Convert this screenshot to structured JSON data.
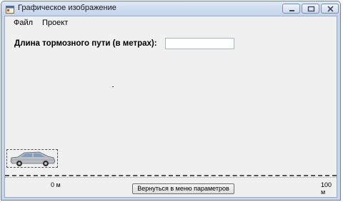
{
  "window": {
    "title": "Графическое изображение"
  },
  "menu": {
    "items": [
      "Файл",
      "Проект"
    ]
  },
  "braking": {
    "label": "Длина тормозного пути (в метрах):",
    "value": ""
  },
  "scale": {
    "start_label": "0 м",
    "end_label": "100 м"
  },
  "buttons": {
    "back": "Вернуться в меню параметров"
  }
}
